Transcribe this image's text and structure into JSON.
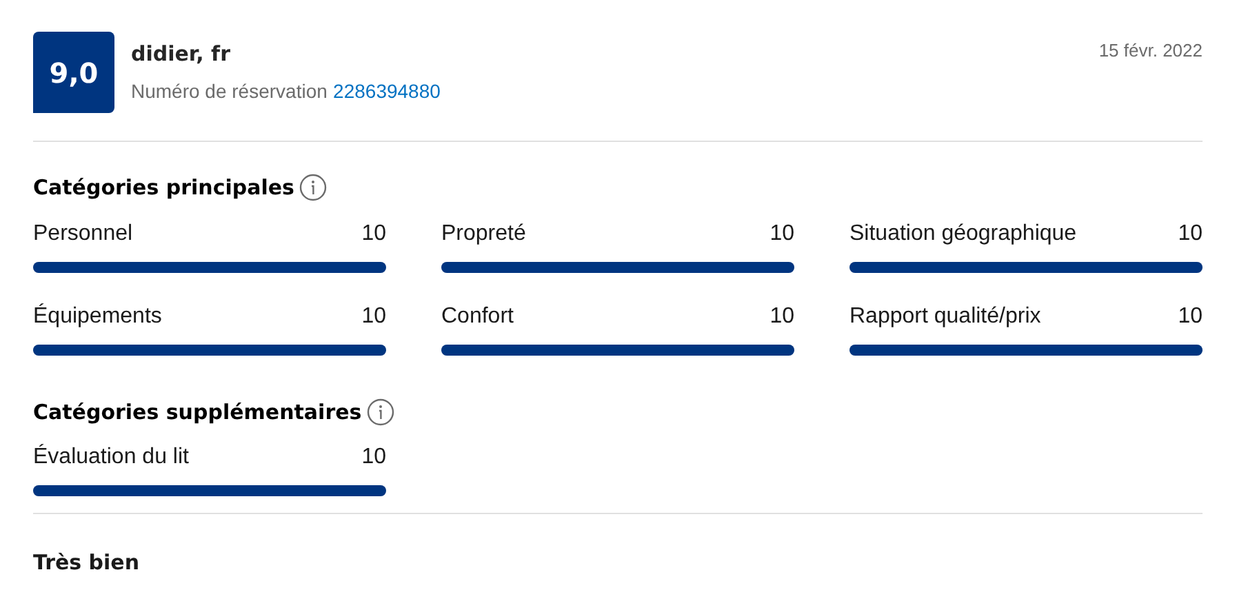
{
  "review": {
    "score": "9,0",
    "reviewer": "didier, fr",
    "booking_label": "Numéro de réservation",
    "booking_number": "2286394880",
    "date": "15 févr. 2022"
  },
  "sections": [
    {
      "title": "Catégories principales",
      "items": [
        {
          "label": "Personnel",
          "score": "10",
          "level": 1
        },
        {
          "label": "Propreté",
          "score": "10",
          "level": 1
        },
        {
          "label": "Situation géographique",
          "score": "10",
          "level": 1
        },
        {
          "label": "Équipements",
          "score": "10",
          "level": 1
        },
        {
          "label": "Confort",
          "score": "10",
          "level": 1
        },
        {
          "label": "Rapport qualité/prix",
          "score": "10",
          "level": 1
        }
      ]
    },
    {
      "title": "Catégories supplémentaires",
      "items": [
        {
          "label": "Évaluation du lit",
          "score": "10",
          "level": 1
        }
      ]
    }
  ],
  "review_title": "Très bien"
}
